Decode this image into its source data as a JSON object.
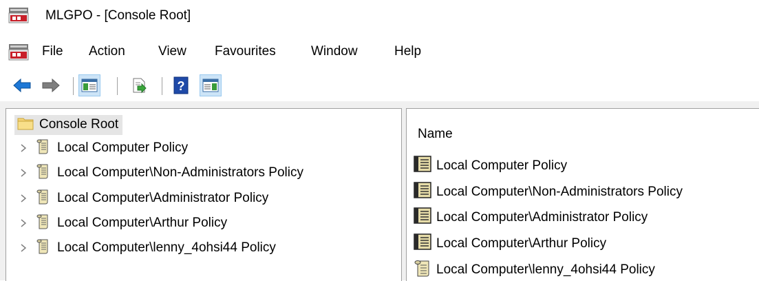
{
  "window": {
    "title": "MLGPO - [Console Root]"
  },
  "menu": {
    "items": [
      {
        "label": "File"
      },
      {
        "label": "Action"
      },
      {
        "label": "View"
      },
      {
        "label": "Favourites"
      },
      {
        "label": "Window"
      },
      {
        "label": "Help"
      }
    ]
  },
  "toolbar": {
    "buttons": [
      {
        "icon": "back-arrow-icon"
      },
      {
        "icon": "forward-arrow-icon"
      },
      {
        "icon": "show-hide-console-tree-icon",
        "pressed": true
      },
      {
        "icon": "export-list-icon"
      },
      {
        "icon": "help-icon"
      },
      {
        "icon": "show-hide-action-pane-icon",
        "pressed": true
      }
    ]
  },
  "tree": {
    "root_label": "Console Root",
    "items": [
      {
        "label": "Local Computer Policy"
      },
      {
        "label": "Local Computer\\Non-Administrators Policy"
      },
      {
        "label": "Local Computer\\Administrator Policy"
      },
      {
        "label": "Local Computer\\Arthur Policy"
      },
      {
        "label": "Local Computer\\lenny_4ohsi44 Policy"
      }
    ]
  },
  "list": {
    "column_header": "Name",
    "items": [
      {
        "label": "Local Computer Policy"
      },
      {
        "label": "Local Computer\\Non-Administrators Policy"
      },
      {
        "label": "Local Computer\\Administrator Policy"
      },
      {
        "label": "Local Computer\\Arthur Policy"
      },
      {
        "label": "Local Computer\\lenny_4ohsi44 Policy"
      }
    ]
  },
  "colors": {
    "selection_bg": "#e5e5e5",
    "pane_border": "#a0a0a0",
    "pressed_bg": "#cce4f7",
    "arrow_blue": "#1e78d6"
  }
}
